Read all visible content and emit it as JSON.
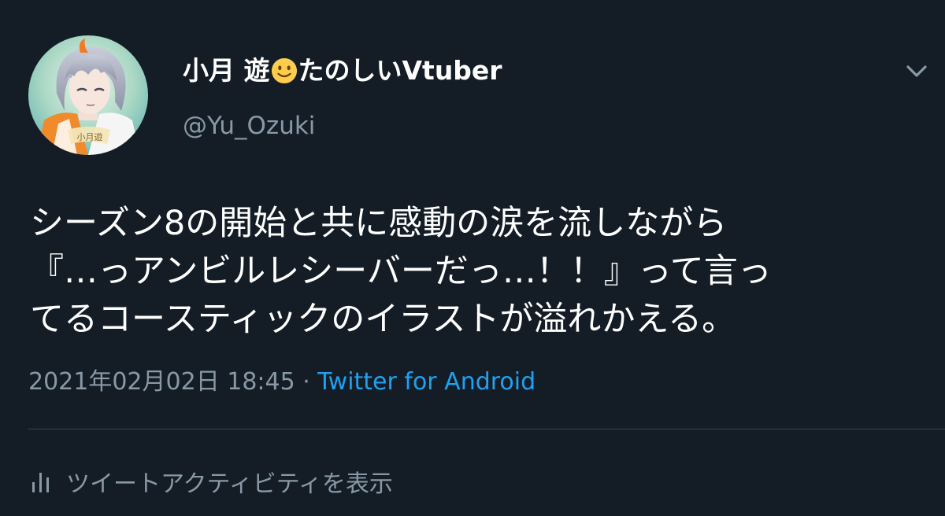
{
  "tweet": {
    "author": {
      "name_part1": "小月 遊",
      "name_emoji": "slightly-smiling-face-emoji",
      "name_part2": "たのしいVtuber",
      "handle": "@Yu_Ozuki"
    },
    "text_lines": [
      "シーズン8の開始と共に感動の涙を流しながら",
      "『…っアンビルレシーバーだっ…！！』って言っ",
      "てるコースティックのイラストが溢れかえる。"
    ],
    "timestamp": "2021年02月02日 18:45",
    "separator": " · ",
    "source": "Twitter for Android",
    "activity_label": "ツイートアクティビティを表示"
  },
  "icons": {
    "caret": "chevron-down-icon",
    "activity": "bar-chart-icon",
    "avatar": "avatar-image"
  },
  "colors": {
    "background": "#141d26",
    "primary_text": "#ffffff",
    "secondary_text": "#8899a6",
    "link": "#1da1f2",
    "divider": "#38444d"
  }
}
